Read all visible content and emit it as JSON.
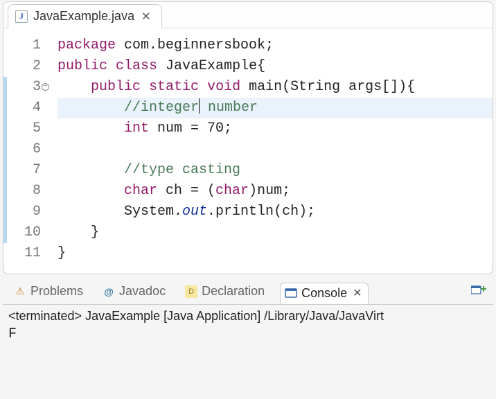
{
  "editor": {
    "tab": {
      "filename": "JavaExample.java"
    },
    "current_line_index": 3,
    "fold_line_index": 2,
    "lines": [
      {
        "n": 1,
        "changed": false,
        "tokens": [
          [
            "kw",
            "package"
          ],
          [
            "",
            " com.beginnersbook;"
          ]
        ]
      },
      {
        "n": 2,
        "changed": false,
        "tokens": [
          [
            "kw",
            "public"
          ],
          [
            "",
            " "
          ],
          [
            "kw",
            "class"
          ],
          [
            "",
            " JavaExample{"
          ]
        ]
      },
      {
        "n": 3,
        "changed": true,
        "tokens": [
          [
            "",
            "    "
          ],
          [
            "kw",
            "public"
          ],
          [
            "",
            " "
          ],
          [
            "kw",
            "static"
          ],
          [
            "",
            " "
          ],
          [
            "kw",
            "void"
          ],
          [
            "",
            " main(String args[]){"
          ]
        ]
      },
      {
        "n": 4,
        "changed": true,
        "tokens": [
          [
            "",
            "        "
          ],
          [
            "comment",
            "//integer"
          ],
          [
            "caret",
            ""
          ],
          [
            "comment",
            " number"
          ]
        ]
      },
      {
        "n": 5,
        "changed": true,
        "tokens": [
          [
            "",
            "        "
          ],
          [
            "kw",
            "int"
          ],
          [
            "",
            " num = 70;"
          ]
        ]
      },
      {
        "n": 6,
        "changed": true,
        "tokens": []
      },
      {
        "n": 7,
        "changed": true,
        "tokens": [
          [
            "",
            "        "
          ],
          [
            "comment",
            "//type casting"
          ]
        ]
      },
      {
        "n": 8,
        "changed": true,
        "tokens": [
          [
            "",
            "        "
          ],
          [
            "kw",
            "char"
          ],
          [
            "",
            " ch = ("
          ],
          [
            "kw",
            "char"
          ],
          [
            "",
            ")num;"
          ]
        ]
      },
      {
        "n": 9,
        "changed": true,
        "tokens": [
          [
            "",
            "        System."
          ],
          [
            "field",
            "out"
          ],
          [
            "",
            ".println(ch);"
          ]
        ]
      },
      {
        "n": 10,
        "changed": true,
        "tokens": [
          [
            "",
            "    }"
          ]
        ]
      },
      {
        "n": 11,
        "changed": false,
        "tokens": [
          [
            "",
            "}"
          ]
        ]
      }
    ]
  },
  "views": {
    "tabs": [
      {
        "id": "problems",
        "label": "Problems",
        "active": false
      },
      {
        "id": "javadoc",
        "label": "Javadoc",
        "active": false
      },
      {
        "id": "declaration",
        "label": "Declaration",
        "active": false
      },
      {
        "id": "console",
        "label": "Console",
        "active": true
      }
    ]
  },
  "console": {
    "status": "<terminated> JavaExample [Java Application] /Library/Java/JavaVirt",
    "output": "F"
  }
}
